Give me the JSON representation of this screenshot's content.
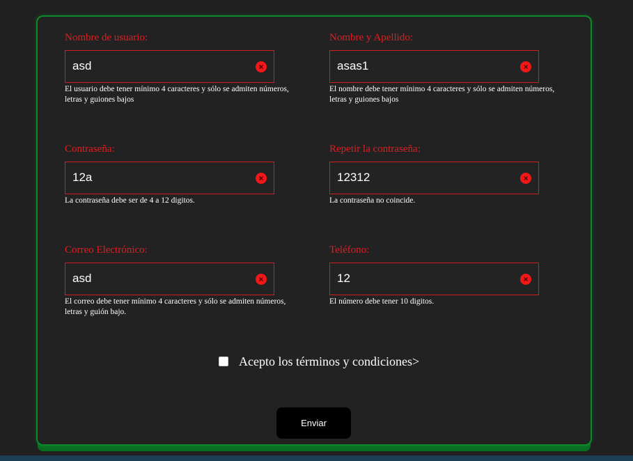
{
  "form": {
    "fields": [
      {
        "label": "Nombre de usuario:",
        "value": "asd",
        "hint": "El usuario debe tener mínimo 4 caracteres y sólo se admiten números, letras y guiones bajos"
      },
      {
        "label": "Nombre y Apellido:",
        "value": "asas1",
        "hint": "El nombre debe tener mínimo 4 caracteres y sólo se admiten números, letras y guiones bajos"
      },
      {
        "label": "Contraseña:",
        "value": "12a",
        "hint": "La contraseña debe ser de 4 a 12 digitos."
      },
      {
        "label": "Repetir la contraseña:",
        "value": "12312",
        "hint": "La contraseña no coincide."
      },
      {
        "label": "Correo Electrónico:",
        "value": "asd",
        "hint": "El correo debe tener mínimo 4 caracteres y sólo se admiten números, letras y guión bajo."
      },
      {
        "label": "Teléfono:",
        "value": "12",
        "hint": "El número debe tener 10 digitos."
      }
    ],
    "terms_label": "Acepto los términos y condiciones>",
    "submit_label": "Enviar"
  },
  "icons": {
    "clear": "clear-icon"
  },
  "colors": {
    "background": "#202020",
    "card_border": "#0d8a2a",
    "error": "#e01e22",
    "button": "#000000"
  }
}
